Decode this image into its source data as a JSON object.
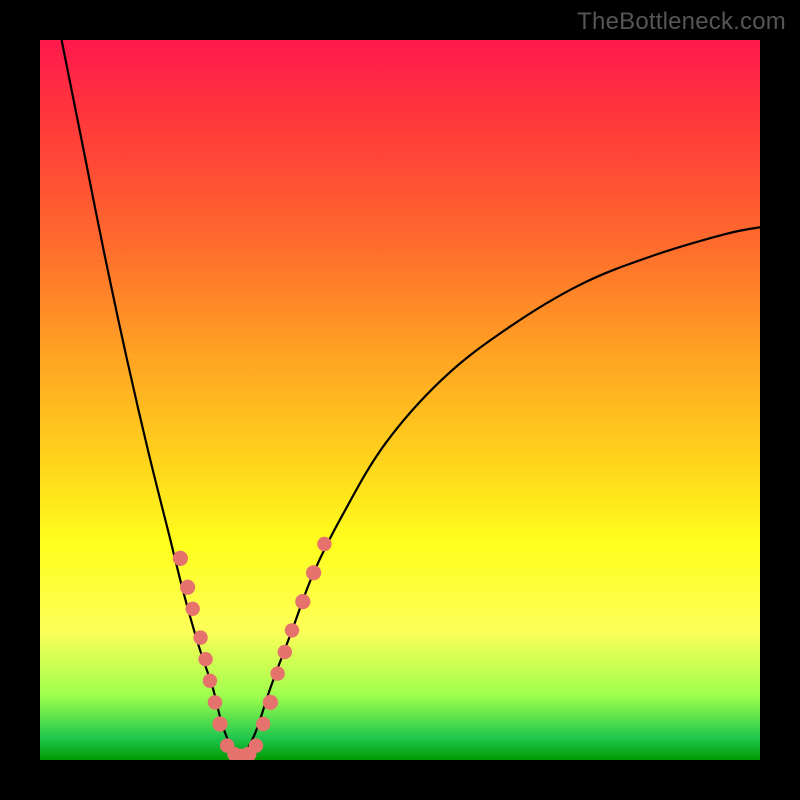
{
  "watermark": {
    "text": "TheBottleneck.com"
  },
  "colors": {
    "bg_black": "#000000",
    "gradient_top": "#ff1a4d",
    "gradient_bottom": "#009900",
    "watermark_gray": "#555555",
    "curve_black": "#000000",
    "bead_fill": "#e6726d",
    "bead_stroke": "#c9524f"
  },
  "chart_data": {
    "type": "line",
    "title": "",
    "xlabel": "",
    "ylabel": "",
    "xlim": [
      0,
      100
    ],
    "ylim": [
      0,
      100
    ],
    "grid": false,
    "legend": null,
    "notes": "Two smooth curves forming a V/valley; y-axis maps to bottleneck percentage (0 = green/no bottleneck at bottom, 100 = red/severe at top). x has no numeric ticks.",
    "series": [
      {
        "name": "left-arm",
        "x": [
          3,
          6,
          9,
          12,
          15,
          18,
          20,
          22,
          24,
          25,
          26,
          27,
          28
        ],
        "values": [
          100,
          85,
          70,
          56,
          43,
          31,
          23,
          16,
          10,
          6,
          3,
          1,
          0
        ]
      },
      {
        "name": "right-arm",
        "x": [
          28,
          30,
          32,
          35,
          38,
          42,
          48,
          56,
          65,
          75,
          85,
          95,
          100
        ],
        "values": [
          0,
          4,
          10,
          18,
          26,
          34,
          44,
          53,
          60,
          66,
          70,
          73,
          74
        ]
      }
    ],
    "beads": {
      "name": "markers",
      "points": [
        {
          "x": 19.5,
          "y": 28,
          "r": 2.3
        },
        {
          "x": 20.5,
          "y": 24,
          "r": 2.3
        },
        {
          "x": 21.2,
          "y": 21,
          "r": 2.1
        },
        {
          "x": 22.3,
          "y": 17,
          "r": 2.1
        },
        {
          "x": 23.0,
          "y": 14,
          "r": 2.1
        },
        {
          "x": 23.6,
          "y": 11,
          "r": 2.1
        },
        {
          "x": 24.3,
          "y": 8,
          "r": 2.1
        },
        {
          "x": 25.0,
          "y": 5,
          "r": 2.3
        },
        {
          "x": 26.0,
          "y": 2,
          "r": 2.1
        },
        {
          "x": 27.0,
          "y": 0.8,
          "r": 2.1
        },
        {
          "x": 28.0,
          "y": 0.5,
          "r": 2.4
        },
        {
          "x": 29.0,
          "y": 0.8,
          "r": 2.3
        },
        {
          "x": 30.0,
          "y": 2,
          "r": 2.1
        },
        {
          "x": 31.0,
          "y": 5,
          "r": 2.1
        },
        {
          "x": 32.0,
          "y": 8,
          "r": 2.3
        },
        {
          "x": 33.0,
          "y": 12,
          "r": 2.1
        },
        {
          "x": 34.0,
          "y": 15,
          "r": 2.1
        },
        {
          "x": 35.0,
          "y": 18,
          "r": 2.1
        },
        {
          "x": 36.5,
          "y": 22,
          "r": 2.3
        },
        {
          "x": 38.0,
          "y": 26,
          "r": 2.3
        },
        {
          "x": 39.5,
          "y": 30,
          "r": 2.1
        }
      ]
    }
  }
}
